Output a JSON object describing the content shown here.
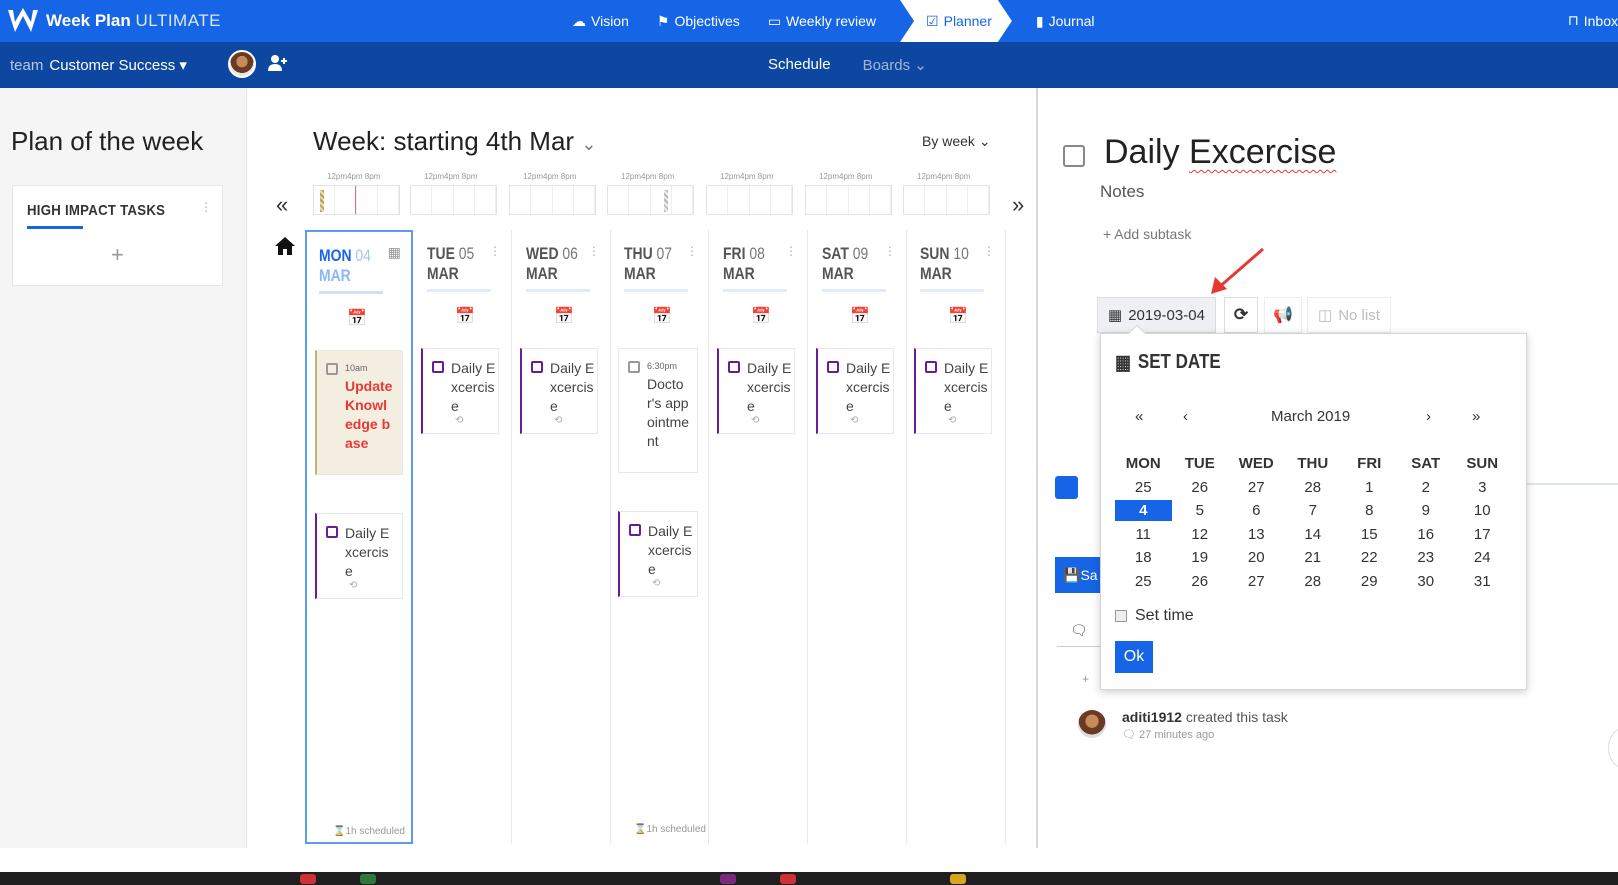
{
  "app": {
    "name": "Week Plan",
    "edition": "ULTIMATE"
  },
  "nav": {
    "items": [
      {
        "label": "Vision",
        "icon": "cloud-icon"
      },
      {
        "label": "Objectives",
        "icon": "flag-icon"
      },
      {
        "label": "Weekly review",
        "icon": "screen-icon"
      },
      {
        "label": "Planner",
        "icon": "calendar-check-icon"
      },
      {
        "label": "Journal",
        "icon": "book-icon"
      }
    ],
    "active": "Planner",
    "inbox": "Inbox"
  },
  "subbar": {
    "team_prefix": "team",
    "team_name": "Customer Success",
    "schedule": "Schedule",
    "boards": "Boards"
  },
  "left": {
    "plan_title": "Plan of the week",
    "card_title": "HIGH IMPACT TASKS",
    "add": "+"
  },
  "week": {
    "title": "Week: starting 4th Mar",
    "view": "By week",
    "timeline_label": "12pm4pm 8pm"
  },
  "days": [
    {
      "dow": "MON",
      "num": "04",
      "mon": "MAR",
      "today": true,
      "scheduled": "1h scheduled"
    },
    {
      "dow": "TUE",
      "num": "05",
      "mon": "MAR"
    },
    {
      "dow": "WED",
      "num": "06",
      "mon": "MAR"
    },
    {
      "dow": "THU",
      "num": "07",
      "mon": "MAR",
      "scheduled": "1h scheduled"
    },
    {
      "dow": "FRI",
      "num": "08",
      "mon": "MAR"
    },
    {
      "dow": "SAT",
      "num": "09",
      "mon": "MAR"
    },
    {
      "dow": "SUN",
      "num": "10",
      "mon": "MAR"
    }
  ],
  "tasks": {
    "mon1": {
      "time": "10am",
      "text": "Update Knowledge base"
    },
    "mon2": {
      "text": "Daily Excercise"
    },
    "tue": {
      "text": "Daily Excercise"
    },
    "wed": {
      "text": "Daily Excercise"
    },
    "thu1": {
      "time": "6:30pm",
      "text": "Doctor's appointment"
    },
    "thu2": {
      "text": "Daily Excercise"
    },
    "fri": {
      "text": "Daily Excercise"
    },
    "sat": {
      "text": "Daily Excercise"
    },
    "sun": {
      "text": "Daily Excercise"
    }
  },
  "detail": {
    "title_a": "Daily ",
    "title_b": "Excercise",
    "notes": "Notes",
    "add_subtask": "+ Add subtask",
    "date": "2019-03-04",
    "no_list": "No list",
    "save": "Sa",
    "activity_user": "aditi1912",
    "activity_text": " created this task",
    "activity_ago": "27 minutes ago"
  },
  "datepicker": {
    "title": "SET DATE",
    "month": "March 2019",
    "prev_year": "«",
    "prev": "‹",
    "next": "›",
    "next_year": "»",
    "weekdays": [
      "MON",
      "TUE",
      "WED",
      "THU",
      "FRI",
      "SAT",
      "SUN"
    ],
    "weeks": [
      [
        "25",
        "26",
        "27",
        "28",
        "1",
        "2",
        "3"
      ],
      [
        "4",
        "5",
        "6",
        "7",
        "8",
        "9",
        "10"
      ],
      [
        "11",
        "12",
        "13",
        "14",
        "15",
        "16",
        "17"
      ],
      [
        "18",
        "19",
        "20",
        "21",
        "22",
        "23",
        "24"
      ],
      [
        "25",
        "26",
        "27",
        "28",
        "29",
        "30",
        "31"
      ]
    ],
    "selected": "4",
    "set_time": "Set time",
    "ok": "Ok"
  },
  "colors": {
    "primary": "#1565e6",
    "dark": "#0d47a1",
    "task_border": "#6a1b9a",
    "highlight_text": "#e53935"
  }
}
